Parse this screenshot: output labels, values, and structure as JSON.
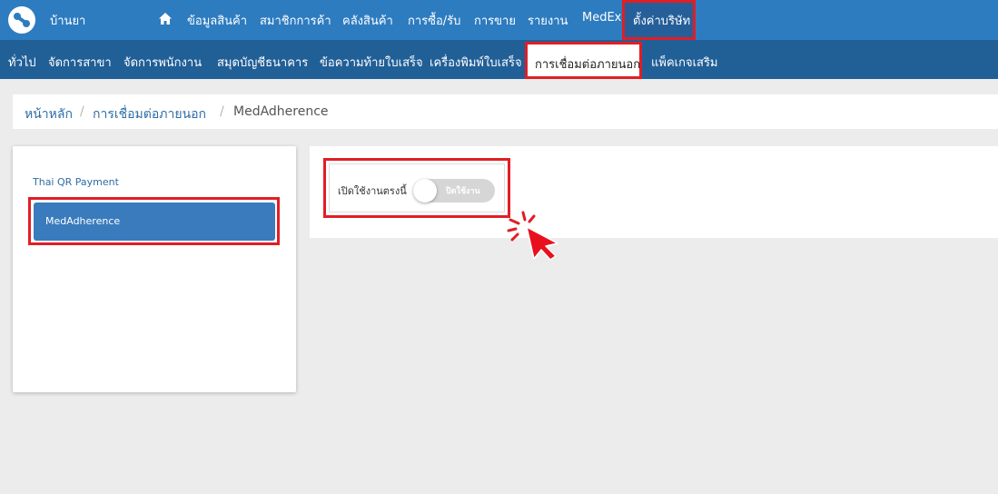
{
  "app": {
    "brand": "บ้านยา"
  },
  "top_nav": {
    "items": [
      "ข้อมูลสินค้า",
      "สมาชิกการค้า",
      "คลังสินค้า",
      "การซื้อ/รับ",
      "การขาย",
      "รายงาน",
      "MedEx"
    ],
    "active": "ตั้งค่าบริษัท"
  },
  "sub_nav": {
    "items": [
      "ทั่วไป",
      "จัดการสาขา",
      "จัดการพนักงาน",
      "สมุดบัญชีธนาคาร",
      "ข้อความท้ายใบเสร็จ",
      "เครื่องพิมพ์ใบเสร็จ"
    ],
    "active": "การเชื่อมต่อภายนอก",
    "after_active": "แพ็คเกจเสริม"
  },
  "breadcrumb": {
    "home": "หน้าหลัก",
    "section": "การเชื่อมต่อภายนอก",
    "current": "MedAdherence",
    "separator": "/"
  },
  "integrations": {
    "items": [
      "Thai QR Payment"
    ],
    "active": "MedAdherence"
  },
  "settings": {
    "toggle_label": "เปิดใช้งานตรงนี้",
    "toggle_state": "ปิดใช้งาน",
    "enabled": false
  },
  "colors": {
    "primary": "#2e7cc0",
    "secondary": "#215f97",
    "highlight": "#e01e25",
    "active_item": "#3a7bbd"
  },
  "icons": {
    "home": "home-icon",
    "pointer": "click-pointer-icon"
  }
}
